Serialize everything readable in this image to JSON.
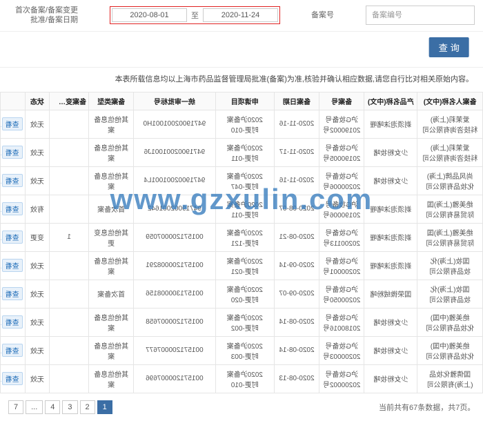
{
  "header": {
    "keywordPlaceholder": "备案编号",
    "filedLabel": "备案号",
    "dateRangeLabel": "首次备案/备案变更\n批准/备案日期",
    "dateFrom": "2020-08-01",
    "dateTo": "2020-11-24",
    "midChar": "至",
    "queryBtn": "查 询"
  },
  "description": "本表所载信息均以上海市药品监督管理局批准(备案)为准,核验并确认相应数据,请您自行比对相关原始内容。",
  "table": {
    "headers": [
      "备案人名称(中文)",
      "产品名称(中文)",
      "备案号",
      "备案日期",
      "申请项目",
      "统一审批标号",
      "备案类型",
      "备案变更次数",
      "状态",
      ""
    ],
    "rows": [
      {
        "company": "爱茉莉(上海)\n科技咨询有限公司",
        "name": "剃须泡沫啫喱",
        "ba": "沪G妆备号\n20190002号",
        "date": "2020-11-16",
        "app": "2020沪备案\n时更-010",
        "uid": "94719002001001H0",
        "type": "其他信息备案",
        "item": "",
        "status": "无效",
        "action": "查看"
      },
      {
        "company": "爱茉莉(上海)\n科技咨询有限公司",
        "name": "少女粉妆啫",
        "ba": "沪G妆备号\n20190005号",
        "date": "2020-11-17",
        "app": "2020沪备案\n时更-011",
        "uid": "94719002001001J6",
        "type": "其他信息备案",
        "item": "",
        "status": "无效",
        "action": "查看"
      },
      {
        "company": "尚风品牌(上海)\n化妆品有限公司",
        "name": "少女粉妆啫",
        "ba": "沪G妆备号\n20200006号",
        "date": "2020-11-16",
        "app": "2020沪备案\n时更-047",
        "uid": "94719002001001L4",
        "type": "其他信息备案",
        "item": "",
        "status": "无效",
        "action": "查看"
      },
      {
        "company": "绝美雅(上海)国\n际贸易有限公司",
        "name": "剃须泡沫啫喱",
        "ba": "沪G妆备号\n20190006号",
        "date": "2020-08-07",
        "app": "2020沪备案\n时更-011",
        "uid": "94719002001642",
        "type": "首次备案",
        "item": "",
        "status": "有效",
        "action": "查看"
      },
      {
        "company": "绝美雅(上海)国\n际贸易有限公司",
        "name": "剃须泡沫啫喱",
        "ba": "沪G妆备号\n20200113号",
        "date": "2020-08-21",
        "app": "2020沪备案\n时更-121",
        "uid": "001571200007059",
        "type": "其他信息变更",
        "item": "1",
        "status": "变更",
        "action": "查看"
      },
      {
        "company": "国妆(上海)化\n妆品有限公司",
        "name": "剃须泡沫啫喱",
        "ba": "沪G妆备号\n20200001号",
        "date": "2020-09-14",
        "app": "2020沪备案\n时更-021",
        "uid": "001571200008291",
        "type": "其他信息备案",
        "item": "",
        "status": "无效",
        "action": "查看"
      },
      {
        "company": "国妆(上海)化\n妆品有限公司",
        "name": "国荣微绒粉啫",
        "ba": "沪G妆备号\n20200050号",
        "date": "2020-09-07",
        "app": "2020沪备案\n时更-020",
        "uid": "001571300008156",
        "type": "首次备案",
        "item": "",
        "status": "无效",
        "action": "查看"
      },
      {
        "company": "绝美雅(中国)\n化妆品有限公司",
        "name": "少女粉妆啫",
        "ba": "沪G妆备号\n20180016号",
        "date": "2020-08-14",
        "app": "2020沪备案\n时更-002",
        "uid": "001571200007658",
        "type": "其他信息备案",
        "item": "",
        "status": "无效",
        "action": "查看"
      },
      {
        "company": "绝美雅(中国)\n化妆品有限公司",
        "name": "少女粉妆啫",
        "ba": "沪G妆备号\n20200003号",
        "date": "2020-08-14",
        "app": "2020沪备案\n时更-003",
        "uid": "001571200007677",
        "type": "其他信息备案",
        "item": "",
        "status": "无效",
        "action": "查看"
      },
      {
        "company": "国倩雅化妆品\n(上海)有限公司",
        "name": "少女粉妆啫",
        "ba": "沪G妆备号\n20200002号",
        "date": "2020-08-13",
        "app": "2020沪备案\n时更-010",
        "uid": "001571200007696",
        "type": "其他信息备案",
        "item": "",
        "status": "无效",
        "action": "查看"
      }
    ]
  },
  "footer": {
    "totalLabel": "当前共有67条数据，共7页。",
    "pages": [
      "1",
      "2",
      "3",
      "4",
      "...",
      "7"
    ]
  },
  "watermark": "www.gzxulin.com"
}
